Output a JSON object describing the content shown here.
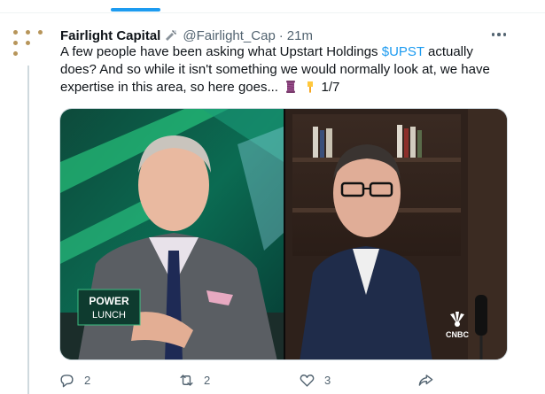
{
  "tweet": {
    "author_name": "Fairlight Capital",
    "author_handle": "@Fairlight_Cap",
    "separator": "·",
    "time": "21m",
    "text_before_cashtag": "A few people have been asking what Upstart Holdings ",
    "cashtag": "$UPST",
    "text_after_cashtag": " actually does? And so while it isn't something we would normally look at, we have expertise in this area, so here goes... ",
    "thread_counter": "1/7",
    "emojis": [
      "thread-spool-emoji",
      "pointing-down-emoji"
    ]
  },
  "media": {
    "show_logo_line1": "POWER",
    "show_logo_line2": "LUNCH",
    "network_logo": "CNBC"
  },
  "actions": {
    "reply_count": "2",
    "retweet_count": "2",
    "like_count": "3"
  },
  "colors": {
    "accent": "#1d9bf0",
    "text_secondary": "#536471",
    "avatar_dots": "#b7955a"
  }
}
